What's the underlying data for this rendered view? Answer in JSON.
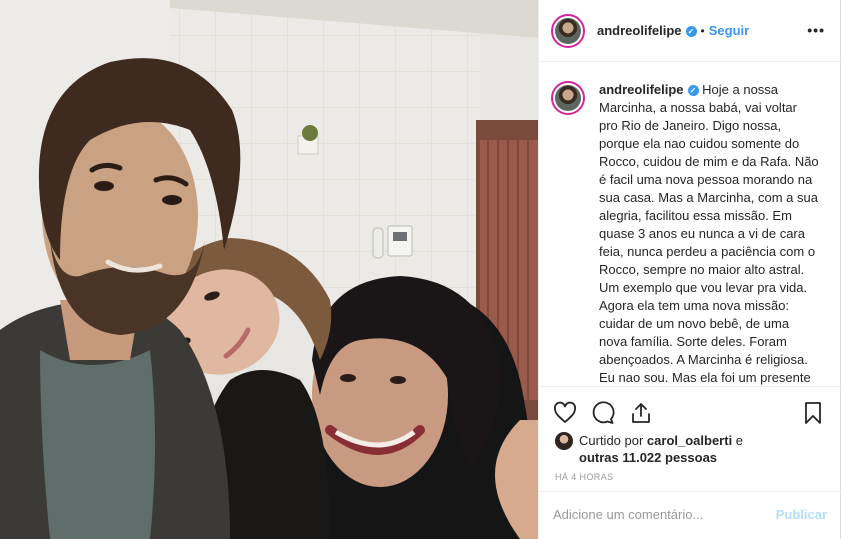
{
  "post": {
    "username": "andreolifelipe",
    "verified_icon": "verified-badge-icon",
    "separator": "•",
    "follow_label": "Seguir",
    "more_icon": "more-options-icon",
    "more_glyph": "•••",
    "caption": "Hoje a nossa Marcinha, a nossa babá, vai voltar pro Rio de Janeiro. Digo nossa, porque ela nao cuidou somente do Rocco, cuidou de mim e da Rafa. Não é facil uma nova pessoa morando na sua casa. Mas a Marcinha, com a sua alegria, facilitou essa missão. Em quase 3 anos eu nunca a vi de cara feia, nunca perdeu a paciência com o Rocco, sempre no maior alto astral. Um exemplo que vou levar pra vida. Agora ela tem uma nova missão: cuidar de um novo bebê, de uma nova família. Sorte deles. Foram abençoados. A Marcinha é religiosa. Eu nao sou. Mas ela foi um presente de Deus. Pra mim, Deus está nos detalhes. Deus está nas pessoas e em"
  },
  "likes": {
    "prefix": "Curtido por ",
    "user": "carol_oalberti",
    "middle": " e ",
    "others": "outras 11.022 pessoas"
  },
  "timestamp": "HÁ 4 HORAS",
  "comment_input": {
    "placeholder": "Adicione um comentário...",
    "value": ""
  },
  "publish_label": "Publicar",
  "colors": {
    "accent": "#3897f0",
    "publish_disabled": "#b2dffc",
    "text": "#262626",
    "muted": "#999999",
    "border": "#efefef"
  }
}
